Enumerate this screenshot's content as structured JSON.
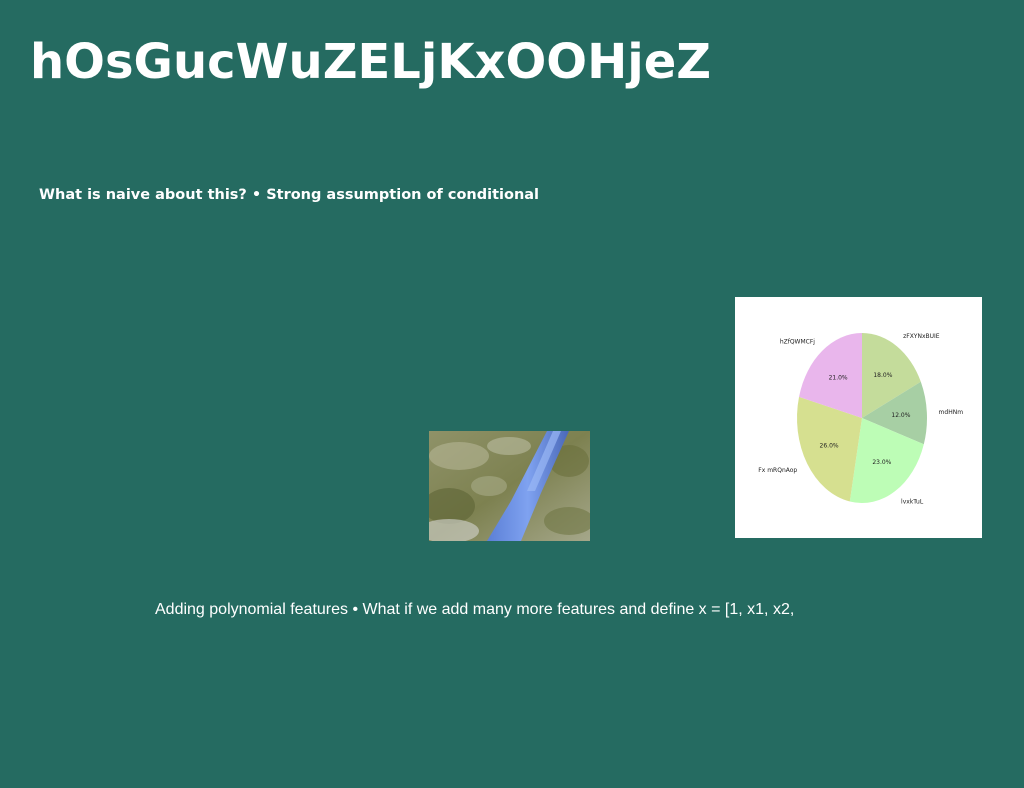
{
  "slide": {
    "title": "hOsGucWuZELjKxOOHjeZ",
    "subtitle": "What is naive about this? • Strong assumption of conditional",
    "body_text": "Adding polynomial features • What if we add many more features and define x = [1, x1, x2,",
    "background_color": "#256b61"
  },
  "chart_data": {
    "type": "pie",
    "slices": [
      {
        "label": "zFXYNxBUIE",
        "value": 18.0,
        "pct_label": "18.0%",
        "color": "#c4dc9b"
      },
      {
        "label": "mdHNm",
        "value": 12.0,
        "pct_label": "12.0%",
        "color": "#a7cfa4"
      },
      {
        "label": "lvxkTuL",
        "value": 23.0,
        "pct_label": "23.0%",
        "color": "#bdfdb6"
      },
      {
        "label": "Fx mRQnAop",
        "value": 26.0,
        "pct_label": "26.0%",
        "color": "#d6e090"
      },
      {
        "label": "hZfQWMCFj",
        "value": 21.0,
        "pct_label": "21.0%",
        "color": "#e9b6ec"
      }
    ],
    "start_angle_deg": 90,
    "direction": "clockwise"
  }
}
